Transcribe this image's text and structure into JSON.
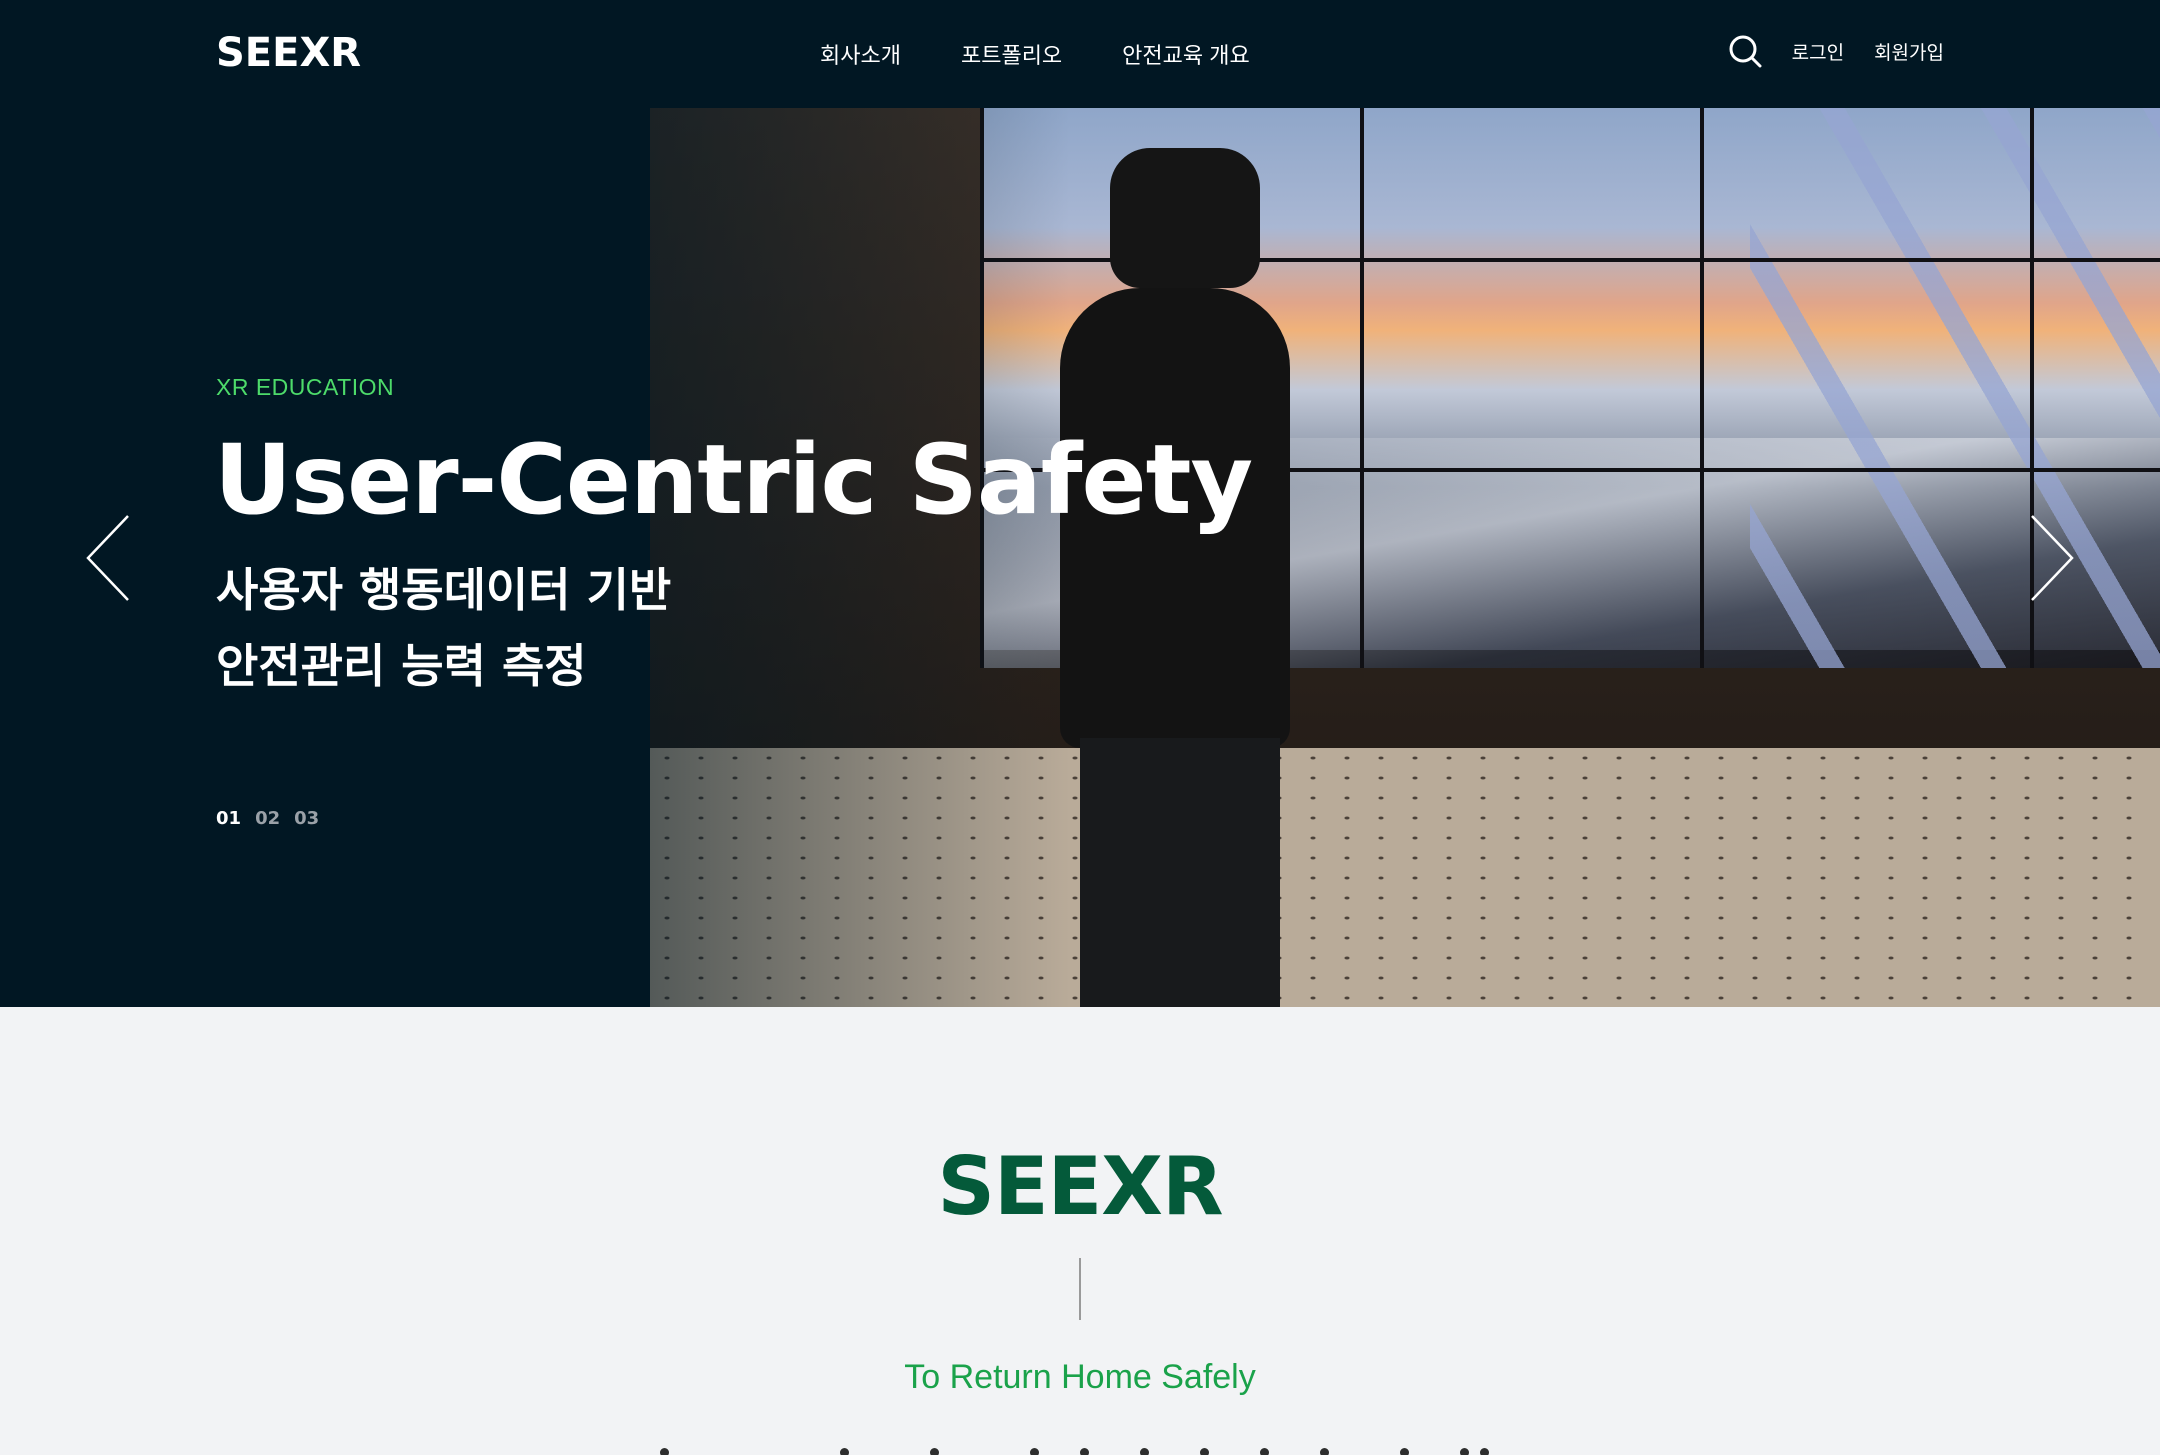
{
  "header": {
    "logo": "SEEXR",
    "nav": [
      "회사소개",
      "포트폴리오",
      "안전교육 개요"
    ],
    "search_icon": "search-icon",
    "login": "로그인",
    "signup": "회원가입"
  },
  "hero": {
    "eyebrow": "XR EDUCATION",
    "title": "User-Centric Safety",
    "subtitle_lines": [
      "사용자 행동데이터 기반",
      "안전관리 능력 측정"
    ],
    "pager": [
      "01",
      "02",
      "03"
    ],
    "active_slide": "01",
    "prev_icon": "chevron-left-icon",
    "next_icon": "chevron-right-icon"
  },
  "intro": {
    "logo": "SEEXR",
    "tagline": "To Return Home Safely"
  },
  "colors": {
    "header_bg": "#011723",
    "accent_green": "#4ddb6a",
    "brand_green": "#045a3a",
    "tagline_green": "#1aa24a",
    "page_bg": "#f2f3f5"
  }
}
